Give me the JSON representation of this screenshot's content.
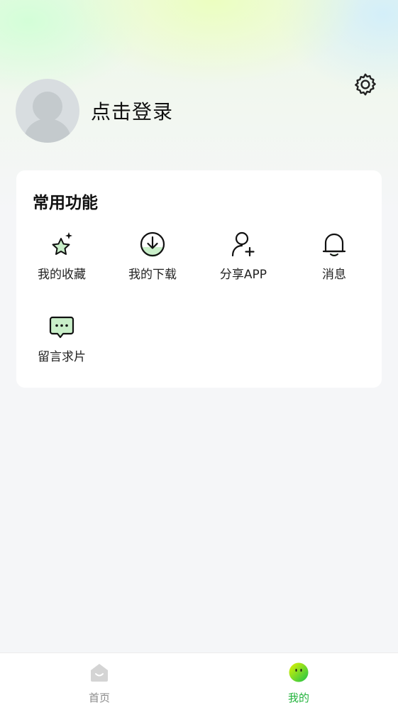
{
  "profile": {
    "login_label": "点击登录"
  },
  "functions": {
    "title": "常用功能",
    "items": [
      {
        "label": "我的收藏",
        "icon": "star-sparkle-icon"
      },
      {
        "label": "我的下载",
        "icon": "download-icon"
      },
      {
        "label": "分享APP",
        "icon": "user-add-icon"
      },
      {
        "label": "消息",
        "icon": "bell-icon"
      },
      {
        "label": "留言求片",
        "icon": "chat-bubble-icon"
      }
    ]
  },
  "tabbar": {
    "tabs": [
      {
        "label": "首页",
        "icon": "home-icon",
        "active": false
      },
      {
        "label": "我的",
        "icon": "face-icon",
        "active": true
      }
    ]
  },
  "colors": {
    "accent": "#22b33c",
    "inactive_tab": "#8a8a8a",
    "icon_fill": "#c9efc9"
  }
}
